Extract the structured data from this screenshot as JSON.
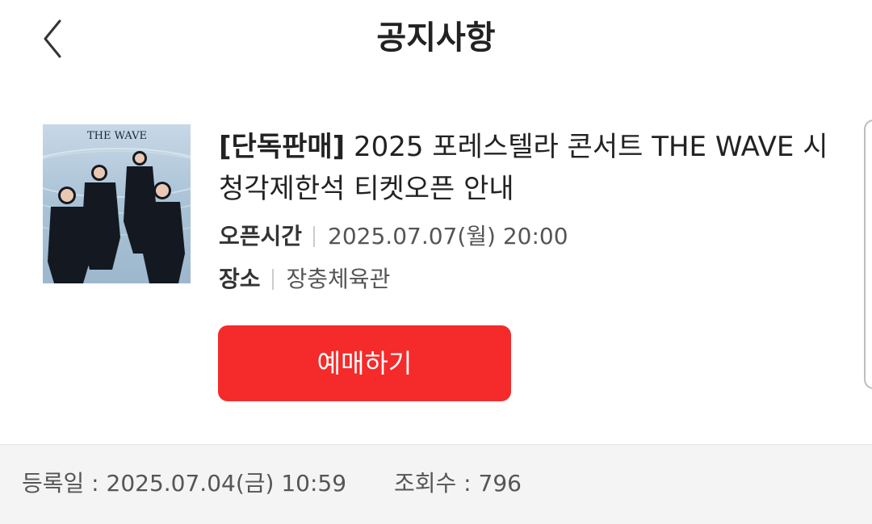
{
  "header": {
    "title": "공지사항",
    "back_icon": "chevron-left-icon"
  },
  "notice": {
    "tag": "[단독판매]",
    "title": "2025 포레스텔라 콘서트 THE WAVE 시청각제한석 티켓오픈 안내",
    "poster_text": "THE WAVE",
    "open_time": {
      "label": "오픈시간",
      "value": "2025.07.07(월) 20:00"
    },
    "place": {
      "label": "장소",
      "value": "장충체육관"
    },
    "book_button": "예매하기"
  },
  "footer": {
    "registered": "등록일 : 2025.07.04(금) 10:59",
    "views": "조회수 : 796"
  },
  "colors": {
    "accent": "#f52a2a",
    "footer_bg": "#f4f4f4"
  }
}
